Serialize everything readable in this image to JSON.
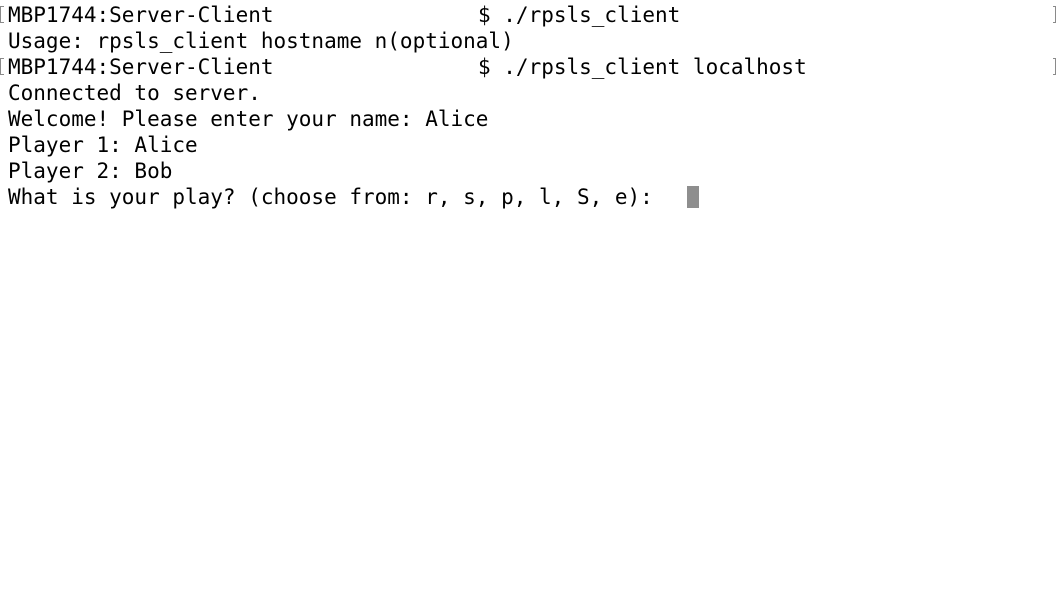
{
  "terminal": {
    "lines": [
      {
        "prompt": "MBP1744:Server-Client",
        "command": "$ ./rpsls_client"
      },
      {
        "text": "Usage: rpsls_client hostname n(optional)"
      },
      {
        "prompt": "MBP1744:Server-Client",
        "command": "$ ./rpsls_client localhost"
      },
      {
        "text": "Connected to server."
      },
      {
        "text": "Welcome! Please enter your name: Alice"
      },
      {
        "text": "Player 1: Alice"
      },
      {
        "text": "Player 2: Bob"
      },
      {
        "text": "What is your play? (choose from: r, s, p, l, S, e): "
      }
    ]
  }
}
